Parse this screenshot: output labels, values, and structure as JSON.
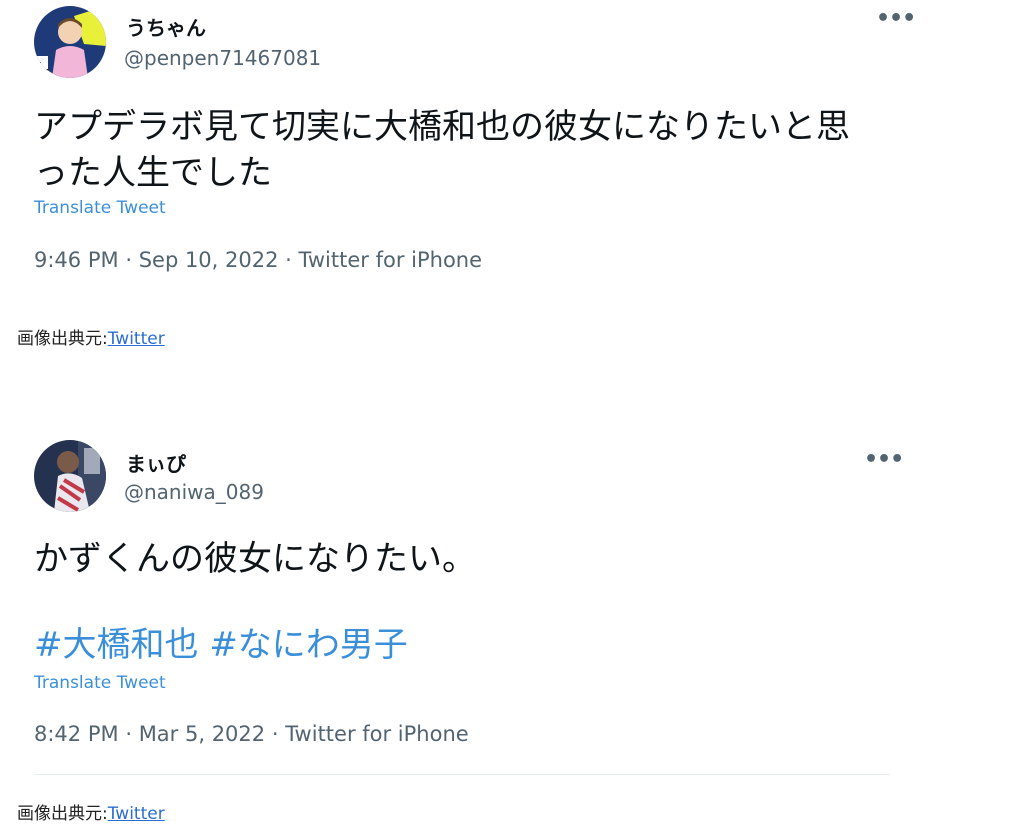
{
  "tweets": [
    {
      "display_name": "うちゃん",
      "handle": "@penpen71467081",
      "text_lines": [
        "アプデラボ見て切実に大橋和也の彼女になりたいと思",
        "った人生でした"
      ],
      "hashtags": [],
      "translate_label": "Translate Tweet",
      "time": "9:46 PM",
      "date": "Sep 10, 2022",
      "client": "Twitter for iPhone",
      "separator": "·",
      "more_icon": "more-icon",
      "avatar_colors": {
        "bg": "#1e3a78",
        "accent": "#e9f03a",
        "shirt": "#f2b6d8"
      }
    },
    {
      "display_name": "まぃぴ",
      "handle": "@naniwa_089",
      "text_lines": [
        "かずくんの彼女になりたい。"
      ],
      "hashtags": [
        "#大橋和也",
        "#なにわ男子"
      ],
      "translate_label": "Translate Tweet",
      "time": "8:42 PM",
      "date": "Mar 5, 2022",
      "client": "Twitter for iPhone",
      "separator": "·",
      "more_icon": "more-icon",
      "avatar_colors": {
        "bg": "#24324f",
        "accent": "#d8d8e0",
        "shirt": "#c23a48"
      }
    }
  ],
  "sources": [
    {
      "label": "画像出典元:",
      "link": "Twitter"
    },
    {
      "label": "画像出典元:",
      "link": "Twitter"
    }
  ],
  "colors": {
    "link": "#3b8fd9",
    "muted": "#536471",
    "text": "#0f1419"
  }
}
